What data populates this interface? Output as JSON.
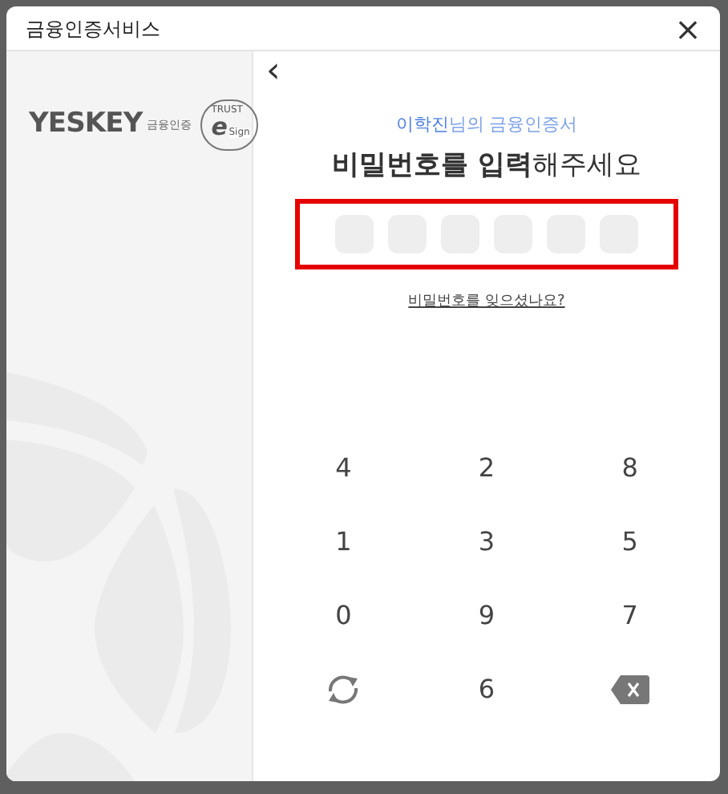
{
  "window": {
    "title": "금융인증서비스",
    "close": "×"
  },
  "brand": {
    "wordmark": "YESKEY",
    "tagline": "금융인증",
    "seal_top": "TRUST",
    "seal_letter": "e",
    "seal_side": "Sign"
  },
  "back": "‹",
  "owner": "**이학진**님의 금융인증서",
  "heading": "**비밀번호를 입력**해주세요",
  "pin_slots": [
    {
      "filled": false
    },
    {
      "filled": false
    },
    {
      "filled": false
    },
    {
      "filled": false
    },
    {
      "filled": false
    },
    {
      "filled": false
    }
  ],
  "pin_highlighted": true,
  "forgot_link": "비밀번호를 잊으셨나요?",
  "keys": [
    {
      "kind": "digit",
      "label": "4"
    },
    {
      "kind": "digit",
      "label": "2"
    },
    {
      "kind": "digit",
      "label": "8"
    },
    {
      "kind": "digit",
      "label": "1"
    },
    {
      "kind": "digit",
      "label": "3"
    },
    {
      "kind": "digit",
      "label": "5"
    },
    {
      "kind": "digit",
      "label": "0"
    },
    {
      "kind": "digit",
      "label": "9"
    },
    {
      "kind": "digit",
      "label": "7"
    },
    {
      "kind": "shuffle"
    },
    {
      "kind": "digit",
      "label": "6"
    },
    {
      "kind": "backspace"
    }
  ]
}
